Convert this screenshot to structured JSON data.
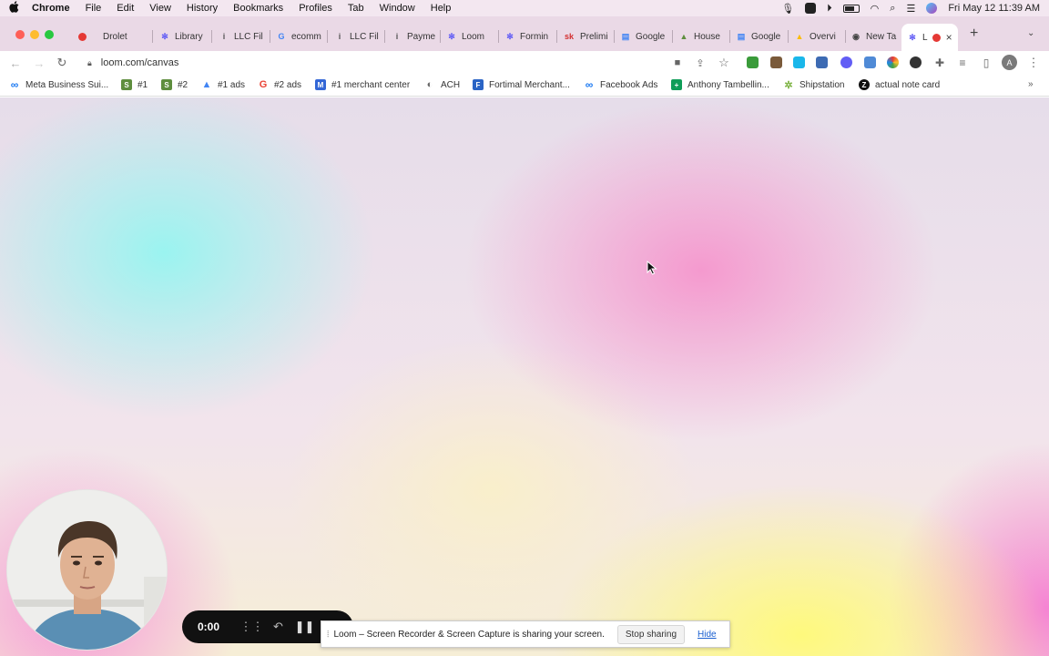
{
  "menubar": {
    "app": "Chrome",
    "items": [
      "File",
      "Edit",
      "View",
      "History",
      "Bookmarks",
      "Profiles",
      "Tab",
      "Window",
      "Help"
    ],
    "clock": "Fri May 12  11:39 AM"
  },
  "tabs": [
    {
      "label": "Drolet",
      "fav": ""
    },
    {
      "label": "Library",
      "fav": "✻"
    },
    {
      "label": "LLC Fil",
      "fav": "i"
    },
    {
      "label": "ecomm",
      "fav": "G"
    },
    {
      "label": "LLC Fil",
      "fav": "i"
    },
    {
      "label": "Payme",
      "fav": "i"
    },
    {
      "label": "Loom",
      "fav": "✻"
    },
    {
      "label": "Formin",
      "fav": "✻"
    },
    {
      "label": "Prelimi",
      "fav": "sk"
    },
    {
      "label": "Google",
      "fav": "▤"
    },
    {
      "label": "House",
      "fav": "▲"
    },
    {
      "label": "Google",
      "fav": "▤"
    },
    {
      "label": "Overvi",
      "fav": "▲"
    },
    {
      "label": "New Ta",
      "fav": "◉"
    },
    {
      "label": "L",
      "fav": "✻"
    }
  ],
  "toolbar": {
    "url": "loom.com/canvas"
  },
  "bookmarks": [
    {
      "label": "Meta Business Sui...",
      "color": "#1877f2",
      "glyph": "∞"
    },
    {
      "label": "#1",
      "color": "#5e8e3e",
      "glyph": "S"
    },
    {
      "label": "#2",
      "color": "#5e8e3e",
      "glyph": "S"
    },
    {
      "label": "#1 ads",
      "color": "#4285f4",
      "glyph": "▲"
    },
    {
      "label": "#2 ads",
      "color": "#ea4335",
      "glyph": "G"
    },
    {
      "label": "#1 merchant center",
      "color": "#3367d6",
      "glyph": "M"
    },
    {
      "label": "ACH",
      "color": "#777777",
      "glyph": "◐"
    },
    {
      "label": "Fortimal Merchant...",
      "color": "#2a64c5",
      "glyph": "F"
    },
    {
      "label": "Facebook Ads",
      "color": "#1877f2",
      "glyph": "∞"
    },
    {
      "label": "Anthony Tambellin...",
      "color": "#0f9d58",
      "glyph": "+"
    },
    {
      "label": "Shipstation",
      "color": "#7cb342",
      "glyph": "✲"
    },
    {
      "label": "actual note card",
      "color": "#111111",
      "glyph": "Z"
    }
  ],
  "recorder": {
    "time": "0:00"
  },
  "share_bar": {
    "message": "Loom – Screen Recorder & Screen Capture is sharing your screen.",
    "stop_label": "Stop sharing",
    "hide_label": "Hide"
  }
}
